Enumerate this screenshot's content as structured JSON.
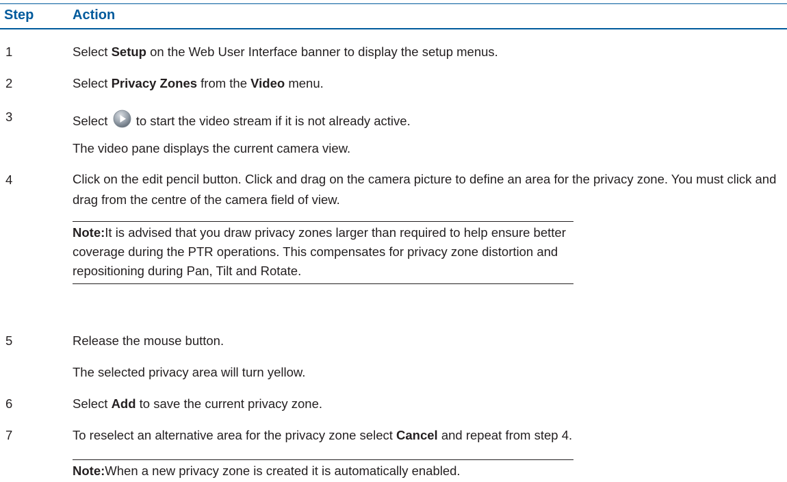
{
  "table": {
    "header_step": "Step",
    "header_action": "Action"
  },
  "rows": {
    "r1": {
      "num": "1",
      "pre": "Select ",
      "b1": "Setup",
      "post": " on the Web User Interface banner to display the setup menus."
    },
    "r2": {
      "num": "2",
      "pre": "Select ",
      "b1": "Privacy Zones",
      "mid": " from the ",
      "b2": "Video",
      "post": " menu."
    },
    "r3": {
      "num": "3",
      "pre": "Select ",
      "post": " to start the video stream if it is not already active.",
      "sub": "The video pane displays the current camera view.",
      "icon": "play-button-icon"
    },
    "r4": {
      "num": "4",
      "text": "Click on the edit pencil button. Click and drag on the camera picture to define an area for the privacy zone. You must click and drag from the centre of the camera field of view."
    },
    "note1": {
      "label": "Note:",
      "text": "It is advised that you draw privacy zones larger than required to help ensure better coverage during the PTR operations. This compensates for privacy zone distortion and repositioning during Pan, Tilt and Rotate."
    },
    "r5": {
      "num": "5",
      "text": "Release the mouse button.",
      "sub": "The selected privacy area will turn yellow."
    },
    "r6": {
      "num": "6",
      "pre": "Select ",
      "b1": "Add",
      "post": " to save the current privacy zone."
    },
    "r7": {
      "num": "7",
      "pre": "To reselect an alternative area for the privacy zone select ",
      "b1": "Cancel",
      "post": " and repeat from step 4."
    },
    "note2": {
      "label": "Note:",
      "text": "When a new privacy zone is created it is automatically enabled."
    }
  },
  "colors": {
    "heading": "#005a9c",
    "text": "#231f20"
  }
}
